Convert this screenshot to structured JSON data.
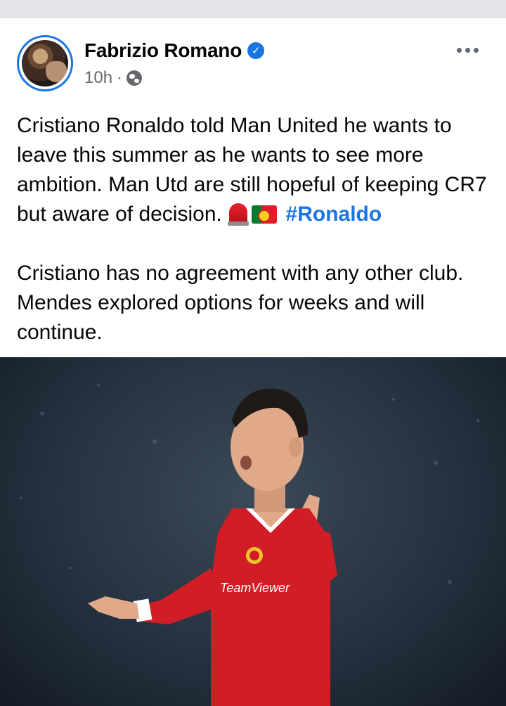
{
  "post": {
    "author_name": "Fabrizio Romano",
    "verified_icon": "verified-badge-icon",
    "timestamp": "10h",
    "separator": "·",
    "audience_icon": "globe-icon",
    "paragraph1_text": "Cristiano Ronaldo told Man United he wants to leave this summer as he wants to see more ambition. Man Utd are still hopeful of keeping CR7 but aware of decision. ",
    "paragraph1_emojis": [
      "siren-emoji",
      "portugal-flag-emoji"
    ],
    "hashtag": "#Ronaldo",
    "paragraph2_text": "Cristiano has no agreement with any other club. Mendes explored options for weeks and will continue.",
    "photo_shirt_text": "TeamViewer"
  },
  "colors": {
    "link": "#1b74e4",
    "text": "#050505",
    "meta": "#65676b",
    "shirt_red": "#d11d25"
  }
}
